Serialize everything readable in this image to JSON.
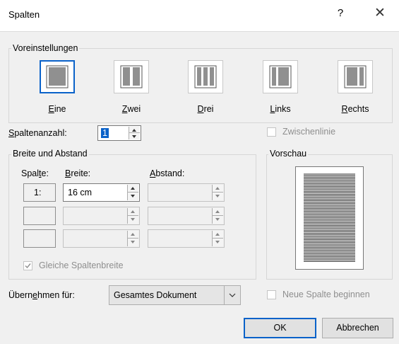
{
  "window": {
    "title": "Spalten",
    "help_label": "?",
    "close_label": "✕"
  },
  "presets": {
    "legend": "Voreinstellungen",
    "items": [
      {
        "label": "Eine",
        "access_key": "E",
        "rest": "ine",
        "selected": true
      },
      {
        "label": "Zwei",
        "access_key": "Z",
        "rest": "wei",
        "selected": false
      },
      {
        "label": "Drei",
        "access_key": "D",
        "rest": "rei",
        "selected": false
      },
      {
        "label": "Links",
        "access_key": "L",
        "rest": "inks",
        "selected": false
      },
      {
        "label": "Rechts",
        "access_key": "R",
        "rest": "echts",
        "selected": false
      }
    ]
  },
  "column_count": {
    "label_key": "S",
    "label_rest": "paltenanzahl:",
    "value": "1"
  },
  "separator_line": {
    "label": "Zwischenlinie",
    "checked": false,
    "enabled": false
  },
  "width_spacing": {
    "legend": "Breite und Abstand",
    "col_header_pre": "Spal",
    "col_header_key": "t",
    "col_header_post": "e:",
    "width_header_key": "B",
    "width_header_rest": "reite:",
    "spacing_header_key": "A",
    "spacing_header_rest": "bstand:",
    "rows": [
      {
        "col": "1:",
        "width": "16 cm",
        "spacing": ""
      },
      {
        "col": "",
        "width": "",
        "spacing": ""
      },
      {
        "col": "",
        "width": "",
        "spacing": ""
      }
    ],
    "equal_width": {
      "label": "Gleiche Spaltenbreite",
      "checked": true,
      "enabled": false
    }
  },
  "preview": {
    "legend": "Vorschau"
  },
  "apply_to": {
    "label_pre": "Übern",
    "label_key": "e",
    "label_post": "hmen für:",
    "value": "Gesamtes Dokument"
  },
  "new_column": {
    "label": "Neue Spalte beginnen",
    "checked": false,
    "enabled": false
  },
  "buttons": {
    "ok": "OK",
    "cancel": "Abbrechen"
  },
  "colors": {
    "accent": "#0a62c9",
    "background": "#f0f0f0",
    "disabled_text": "#8e8e8e"
  }
}
